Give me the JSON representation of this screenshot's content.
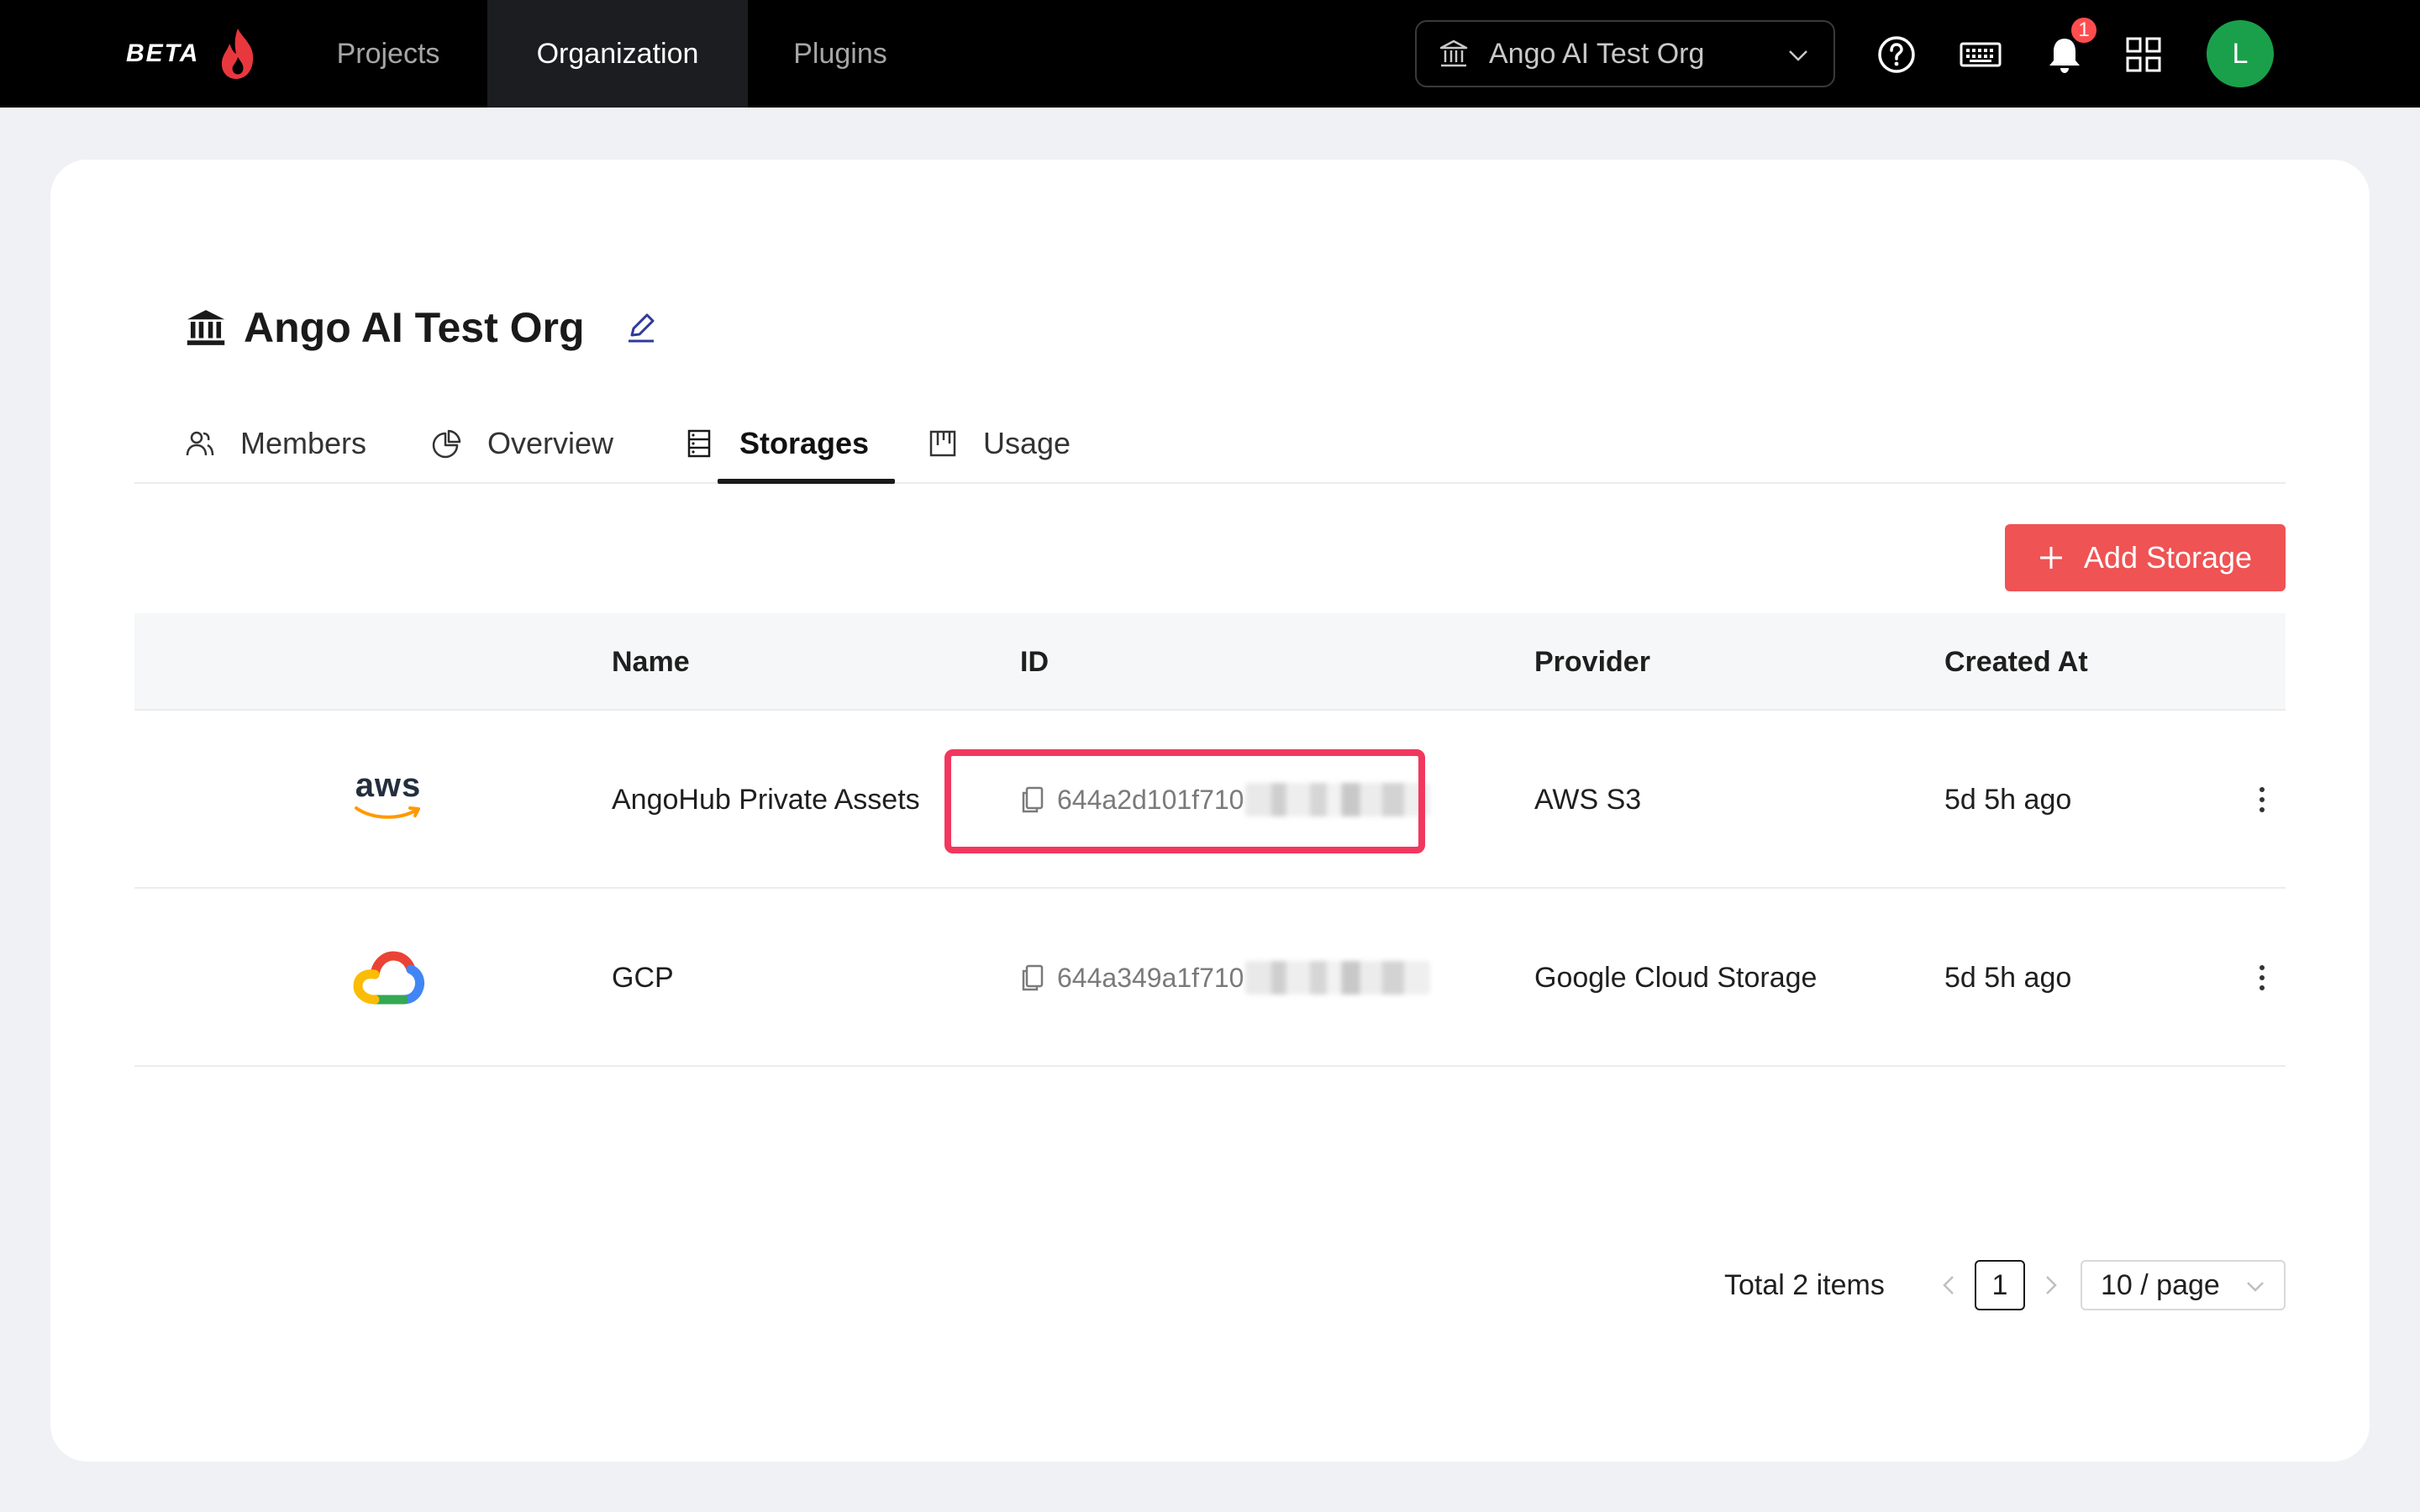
{
  "topbar": {
    "brand": "BETA",
    "nav": [
      {
        "label": "Projects"
      },
      {
        "label": "Organization"
      },
      {
        "label": "Plugins"
      }
    ],
    "org_select": "Ango AI Test Org",
    "notification_count": "1",
    "avatar_initial": "L"
  },
  "page": {
    "title": "Ango AI Test Org",
    "tabs": [
      {
        "label": "Members"
      },
      {
        "label": "Overview"
      },
      {
        "label": "Storages"
      },
      {
        "label": "Usage"
      }
    ],
    "add_button": "Add Storage"
  },
  "table": {
    "columns": [
      "Name",
      "ID",
      "Provider",
      "Created At"
    ],
    "rows": [
      {
        "logo": "aws-logo",
        "logo_text": "aws",
        "name": "AngoHub Private Assets",
        "id": "644a2d101f710",
        "provider": "AWS S3",
        "created": "5d 5h ago"
      },
      {
        "logo": "gcp-logo",
        "name": "GCP",
        "id": "644a349a1f710",
        "provider": "Google Cloud Storage",
        "created": "5d 5h ago"
      }
    ]
  },
  "pagination": {
    "total": "Total 2 items",
    "current_page": "1",
    "page_size": "10 / page"
  },
  "colors": {
    "accent": "#ef5354",
    "highlight": "#f2375f",
    "avatar": "#1aa04b"
  }
}
